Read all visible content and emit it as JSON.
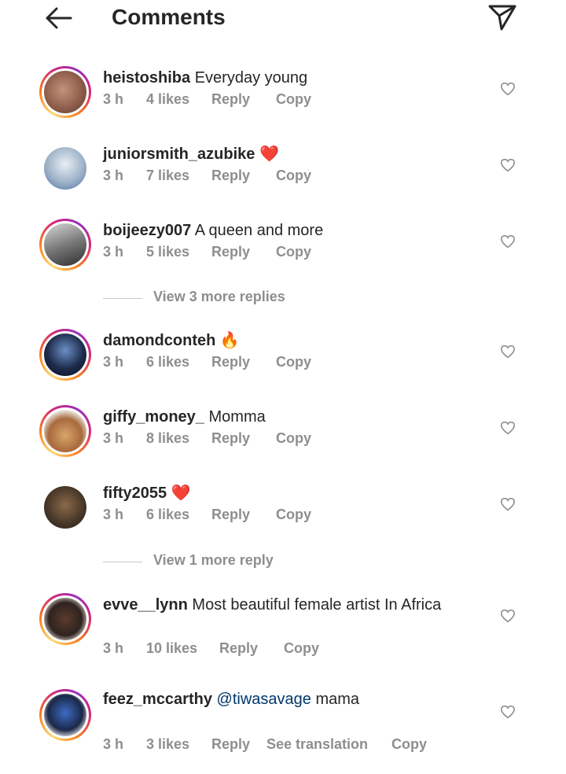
{
  "header": {
    "title": "Comments",
    "back_icon": "arrow-left-icon",
    "send_icon": "paper-plane-icon"
  },
  "comments": [
    {
      "username": "heistoshiba",
      "text": "Everyday young",
      "time": "3 h",
      "likes": "4 likes",
      "reply": "Reply",
      "copy": "Copy"
    },
    {
      "username": "juniorsmith_azubike",
      "text": "❤️",
      "time": "3 h",
      "likes": "7 likes",
      "reply": "Reply",
      "copy": "Copy"
    },
    {
      "username": "boijeezy007",
      "text": "A queen and more",
      "time": "3 h",
      "likes": "5 likes",
      "reply": "Reply",
      "copy": "Copy"
    },
    {
      "username": "damondconteh",
      "text": "🔥",
      "time": "3 h",
      "likes": "6 likes",
      "reply": "Reply",
      "copy": "Copy"
    },
    {
      "username": "giffy_money_",
      "text": "Momma",
      "time": "3 h",
      "likes": "8 likes",
      "reply": "Reply",
      "copy": "Copy"
    },
    {
      "username": "fifty2055",
      "text": "❤️",
      "time": "3 h",
      "likes": "6 likes",
      "reply": "Reply",
      "copy": "Copy"
    },
    {
      "username": "evve__lynn",
      "text": "Most beautiful female artist In Africa",
      "time": "3 h",
      "likes": "10 likes",
      "reply": "Reply",
      "copy": "Copy"
    },
    {
      "username": "feez_mccarthy",
      "mention": "@tiwasavage",
      "text": "mama",
      "time": "3 h",
      "likes": "3 likes",
      "reply": "Reply",
      "see_translation": "See translation",
      "copy": "Copy"
    }
  ],
  "view_replies": [
    {
      "label": "View 3 more replies"
    },
    {
      "label": "View 1 more reply"
    }
  ],
  "colors": {
    "text": "#262626",
    "secondary": "#8e8e8e",
    "mention": "#00376b",
    "heart": "#e0245e"
  }
}
